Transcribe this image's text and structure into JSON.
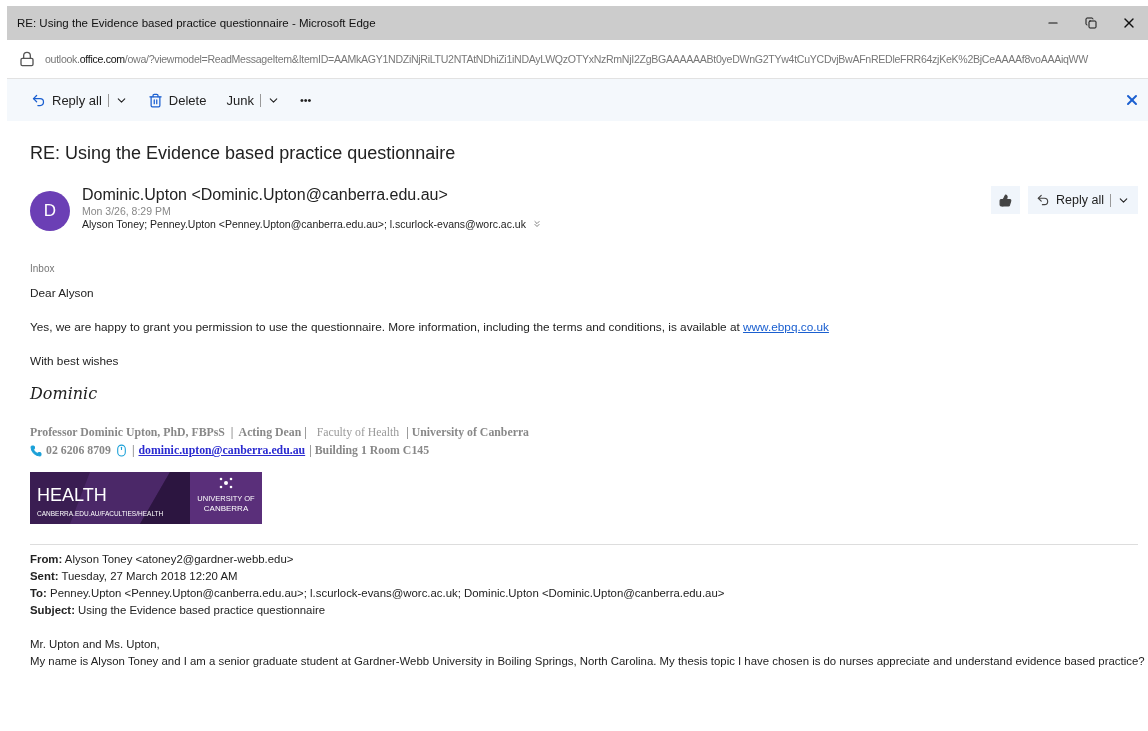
{
  "window": {
    "title": "RE: Using the Evidence based practice questionnaire - Microsoft Edge"
  },
  "address_bar": {
    "host_prefix": "outlook.",
    "host_main": "office.com",
    "path": "/owa/?viewmodel=ReadMessageItem&ItemID=AAMkAGY1NDZiNjRiLTU2NTAtNDhiZi1iNDAyLWQzOTYxNzRmNjI2ZgBGAAAAAABt0yeDWnG2TYw4tCuYCDvjBwAFnREDleFRR64zjKeK%2BjCeAAAAf8voAAAiqWW"
  },
  "toolbar": {
    "items": [
      {
        "kind": "reply",
        "label": "Reply all"
      },
      {
        "kind": "delete",
        "label": "Delete"
      },
      {
        "kind": "junk",
        "label": "Junk"
      },
      {
        "kind": "more",
        "label": "•••"
      }
    ]
  },
  "message": {
    "subject": "RE: Using the Evidence based practice questionnaire",
    "avatar": "D",
    "sender": "Dominic.Upton <Dominic.Upton@canberra.edu.au>",
    "date": "Mon 3/26, 8:29 PM",
    "recipients": "Alyson Toney; Penney.Upton <Penney.Upton@canberra.edu.au>; l.scurlock-evans@worc.ac.uk",
    "reply_label": "Reply all",
    "folder": "Inbox"
  },
  "body": {
    "greeting": "Dear Alyson",
    "text": "Yes, we are happy to grant you permission to use the questionnaire. More information, including the terms and conditions, is available at ",
    "link": "www.ebpq.co.uk",
    "closing": "With best wishes",
    "signature_name": "Dominic"
  },
  "signature": {
    "line1": [
      {
        "text": "Professor Dominic Upton, PhD, FBPsS  |  Acting Dean | ",
        "kind": "bold"
      },
      {
        "text": " Faculty of Health",
        "kind": "light"
      },
      {
        "text": " | University of Canberra",
        "kind": "bold"
      }
    ],
    "phone": "02 6206 8709",
    "separator": "|",
    "email": "dominic.upton@canberra.edu.au",
    "location": "| Building 1 Room C145",
    "banner": {
      "title": "HEALTH",
      "url": "CANBERRA.EDU.AU/FACULTIES/HEALTH",
      "uni_top": "UNIVERSITY OF",
      "uni_bottom": "CANBERRA"
    }
  },
  "quoted": {
    "fields": [
      {
        "label": "From:",
        "value": "Alyson Toney <atoney2@gardner-webb.edu>"
      },
      {
        "label": "Sent:",
        "value": "Tuesday, 27 March 2018 12:20 AM"
      },
      {
        "label": "To:",
        "value": "Penney.Upton <Penney.Upton@canberra.edu.au>; l.scurlock-evans@worc.ac.uk; Dominic.Upton <Dominic.Upton@canberra.edu.au>"
      },
      {
        "label": "Subject:",
        "value": "Using the Evidence based practice questionnaire"
      }
    ],
    "salutation": "Mr. Upton and Ms. Upton,",
    "text": "My name is Alyson Toney and I am a senior graduate student at Gardner-Webb University in Boiling Springs, North Carolina. My thesis topic I have chosen is do nurses appreciate and understand evidence based practice?"
  }
}
